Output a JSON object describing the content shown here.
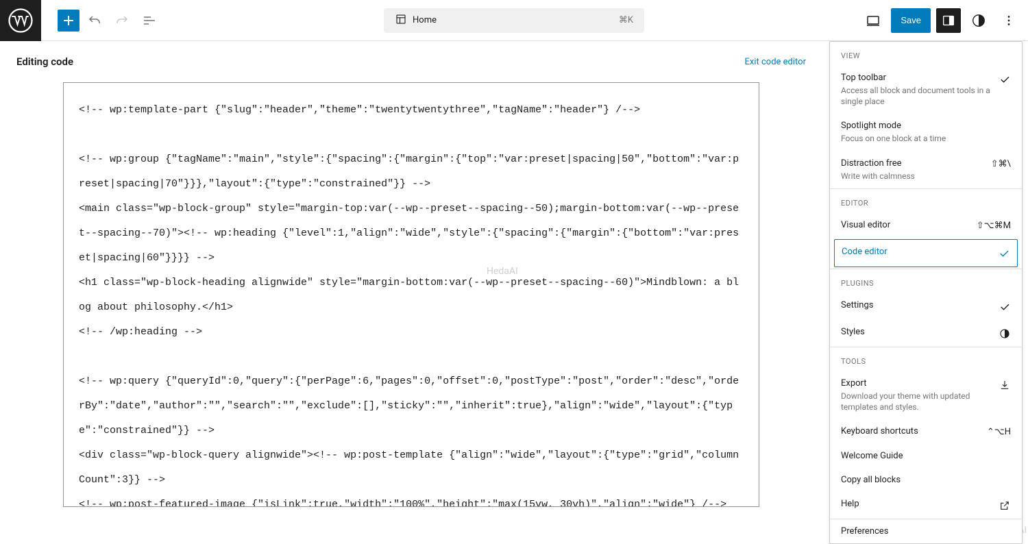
{
  "topbar": {
    "home_label": "Home",
    "shortcut": "⌘K",
    "save_label": "Save"
  },
  "editing_bar": {
    "label": "Editing code",
    "exit_label": "Exit code editor"
  },
  "code": "<!-- wp:template-part {\"slug\":\"header\",\"theme\":\"twentytwentythree\",\"tagName\":\"header\"} /-->\n\n<!-- wp:group {\"tagName\":\"main\",\"style\":{\"spacing\":{\"margin\":{\"top\":\"var:preset|spacing|50\",\"bottom\":\"var:preset|spacing|70\"}}},\"layout\":{\"type\":\"constrained\"}} -->\n<main class=\"wp-block-group\" style=\"margin-top:var(--wp--preset--spacing--50);margin-bottom:var(--wp--preset--spacing--70)\"><!-- wp:heading {\"level\":1,\"align\":\"wide\",\"style\":{\"spacing\":{\"margin\":{\"bottom\":\"var:preset|spacing|60\"}}}} -->\n<h1 class=\"wp-block-heading alignwide\" style=\"margin-bottom:var(--wp--preset--spacing--60)\">Mindblown: a blog about philosophy.</h1>\n<!-- /wp:heading -->\n\n<!-- wp:query {\"queryId\":0,\"query\":{\"perPage\":6,\"pages\":0,\"offset\":0,\"postType\":\"post\",\"order\":\"desc\",\"orderBy\":\"date\",\"author\":\"\",\"search\":\"\",\"exclude\":[],\"sticky\":\"\",\"inherit\":true},\"align\":\"wide\",\"layout\":{\"type\":\"constrained\"}} -->\n<div class=\"wp-block-query alignwide\"><!-- wp:post-template {\"align\":\"wide\",\"layout\":{\"type\":\"grid\",\"columnCount\":3}} -->\n<!-- wp:post-featured-image {\"isLink\":true,\"width\":\"100%\",\"height\":\"max(15vw, 30vh)\",\"align\":\"wide\"} /-->",
  "dropdown": {
    "view_label": "VIEW",
    "top_toolbar": {
      "title": "Top toolbar",
      "desc": "Access all block and document tools in a single place"
    },
    "spotlight": {
      "title": "Spotlight mode",
      "desc": "Focus on one block at a time"
    },
    "distraction": {
      "title": "Distraction free",
      "desc": "Write with calmness",
      "shortcut": "⇧⌘\\"
    },
    "editor_label": "EDITOR",
    "visual_editor": {
      "title": "Visual editor",
      "shortcut": "⇧⌥⌘M"
    },
    "code_editor": {
      "title": "Code editor"
    },
    "plugins_label": "PLUGINS",
    "settings": {
      "title": "Settings"
    },
    "styles": {
      "title": "Styles"
    },
    "tools_label": "TOOLS",
    "export": {
      "title": "Export",
      "desc": "Download your theme with updated templates and styles."
    },
    "keyboard": {
      "title": "Keyboard shortcuts",
      "shortcut": "⌃⌥H"
    },
    "welcome": {
      "title": "Welcome Guide"
    },
    "copy_all": {
      "title": "Copy all blocks"
    },
    "help": {
      "title": "Help"
    },
    "preferences": {
      "title": "Preferences"
    }
  },
  "watermark": "HedaAI"
}
